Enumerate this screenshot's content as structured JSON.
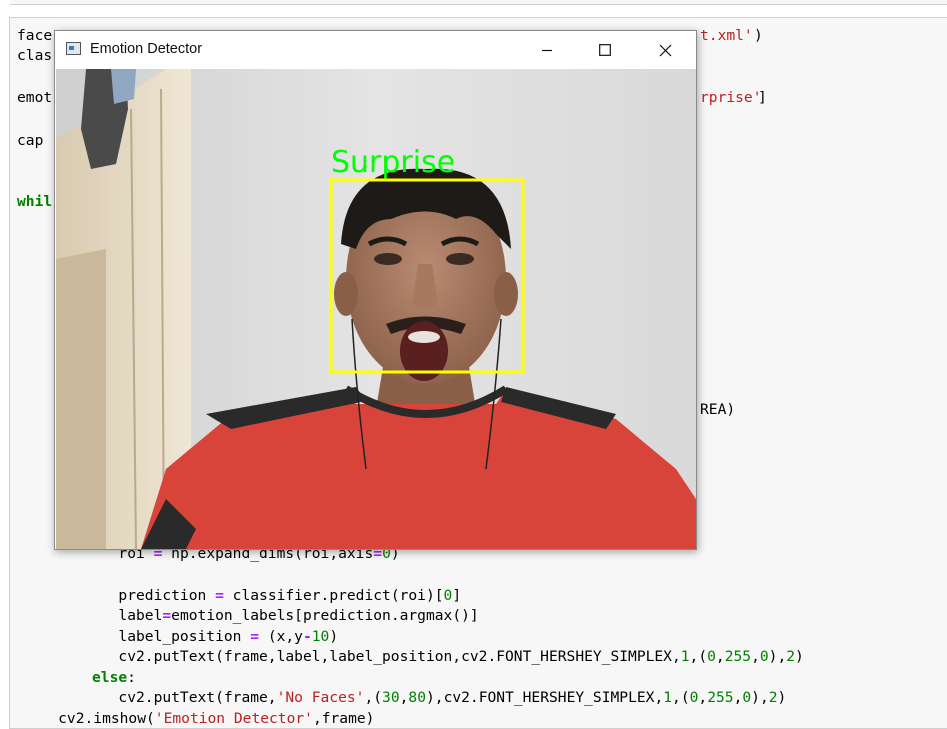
{
  "window": {
    "title": "Emotion Detector",
    "detected_label": "Surprise",
    "box_color": "#ffff00",
    "label_color": "#00ff00"
  },
  "code": {
    "line1_a": "face",
    "line1_b": "t.xml'",
    "line1_c": ")",
    "line2": "clas",
    "line3_a": "emot",
    "line3_b": "rprise'",
    "line3_c": "]",
    "line4": "cap",
    "line5": "whil",
    "line6": "REA)",
    "roi_a": "            roi ",
    "roi_b": " np.expand_dims(roi,axis",
    "roi_c": "0",
    "roi_d": ")",
    "pred_a": "            prediction ",
    "pred_b": " classifier.predict(roi)[",
    "pred_c": "0",
    "pred_d": "]",
    "label_a": "            label",
    "label_b": "emotion_labels[prediction.argmax()]",
    "lpos_a": "            label_position ",
    "lpos_b": " (x,y",
    "lpos_c": "10",
    "lpos_d": ")",
    "put1_a": "            cv2.putText(frame,label,label_position,cv2.FONT_HERSHEY_SIMPLEX,",
    "put1_b": "1",
    "put1_c": ",(",
    "put1_d": "0",
    "put1_e": ",",
    "put1_f": "255",
    "put1_g": ",",
    "put1_h": "0",
    "put1_i": "),",
    "put1_j": "2",
    "put1_k": ")",
    "else_kw": "else",
    "else_colon": ":",
    "put2_a": "            cv2.putText(frame,",
    "put2_b": "'No Faces'",
    "put2_c": ",(",
    "put2_d": "30",
    "put2_e": ",",
    "put2_f": "80",
    "put2_g": "),cv2.FONT_HERSHEY_SIMPLEX,",
    "put2_h": "1",
    "put2_i": ",(",
    "put2_j": "0",
    "put2_k": ",",
    "put2_l": "255",
    "put2_m": ",",
    "put2_n": "0",
    "put2_o": "),",
    "put2_p": "2",
    "put2_q": ")",
    "imshow_a": "    cv2.imshow(",
    "imshow_b": "'Emotion Detector'",
    "imshow_c": ",frame)"
  },
  "ops": {
    "eq": "=",
    "minus": "-"
  },
  "icons": [
    "app-icon",
    "minimize-icon",
    "maximize-icon",
    "close-icon"
  ]
}
